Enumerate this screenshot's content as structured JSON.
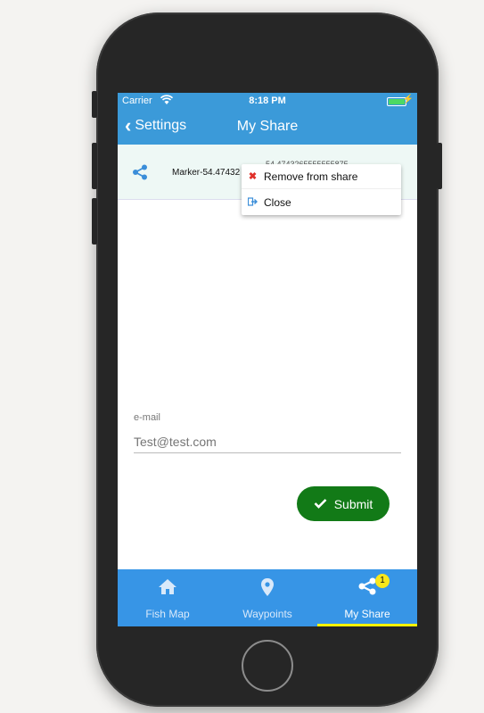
{
  "status_bar": {
    "carrier": "Carrier",
    "time": "8:18 PM"
  },
  "nav": {
    "back_label": "Settings",
    "title": "My Share"
  },
  "list": {
    "row_label": "Marker-54.47432",
    "row_value_partial": "54.4743265555555875"
  },
  "context_menu": {
    "items": [
      {
        "label": "Remove from share",
        "icon": "x-icon"
      },
      {
        "label": "Close",
        "icon": "exit-icon"
      }
    ]
  },
  "form": {
    "email_label": "e-mail",
    "email_placeholder": "Test@test.com",
    "submit_label": "Submit"
  },
  "tabbar": {
    "tabs": [
      {
        "label": "Fish Map",
        "icon": "home-icon"
      },
      {
        "label": "Waypoints",
        "icon": "map-pin-icon"
      },
      {
        "label": "My Share",
        "icon": "share-icon",
        "badge": "1",
        "active": true
      }
    ]
  },
  "colors": {
    "header": "#3b9ad9",
    "tabbar": "#3795e6",
    "submit": "#127a17",
    "active_underline": "#fff200",
    "badge": "#f8e71c"
  }
}
